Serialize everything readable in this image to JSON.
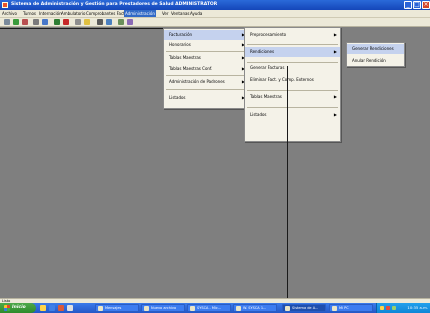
{
  "window": {
    "title": "Sistema de Administración y Gestión para Prestadores de Salud  ADMINISTRATOR",
    "minimize": "_",
    "maximize": "□",
    "close": "×"
  },
  "menubar": [
    "Archivo",
    "Turnos",
    "Internación",
    "Ambulatorio",
    "Comprobantes Fact.",
    "Administración",
    "Ver",
    "Ventanas",
    "Ayuda"
  ],
  "menu_l1": {
    "items": [
      "Facturación",
      "Honorarios",
      "Tablas Maestras",
      "Tablas Maestras Conf.",
      "Administración de Padrones",
      "Listados"
    ]
  },
  "menu_l2": {
    "items": [
      "Preprocesamiento",
      "Rendiciones",
      "Generar Facturas",
      "Eliminar Fact. y Comp. Externos",
      "Tablas Maestras",
      "Listados"
    ]
  },
  "menu_l3": {
    "items": [
      "Generar Rendiciones",
      "Anular Rendición"
    ]
  },
  "statusbar": {
    "text": "Listo"
  },
  "taskbar": {
    "start": "Inicio",
    "tasks": [
      "Mensajes",
      "Nuevo archivo",
      "SYSCA - Mic...",
      "W. SYSCA 1...",
      "Sistema de A...",
      "Mi PC"
    ],
    "clock": "10:35 a.m."
  }
}
